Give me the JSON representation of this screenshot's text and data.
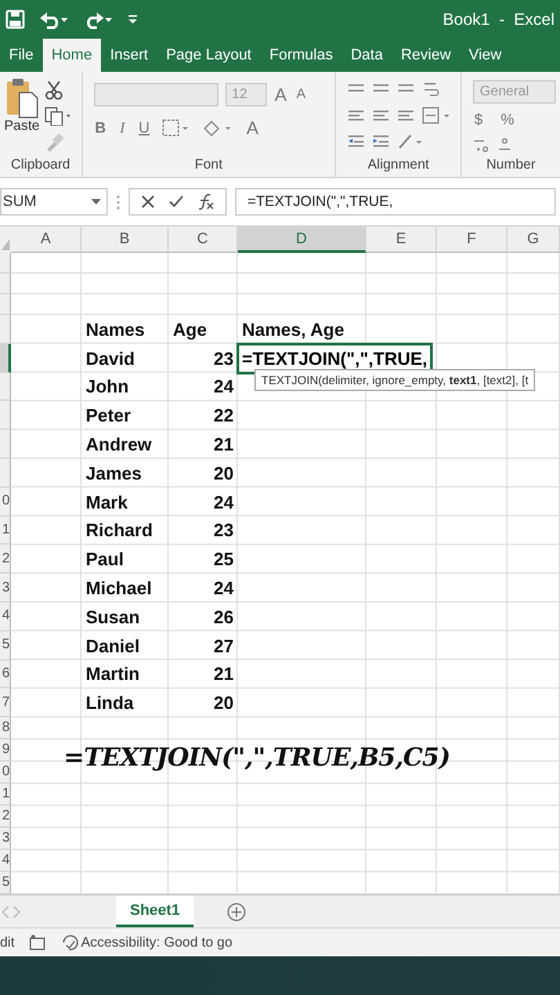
{
  "title_bar": {
    "title": "Book1  -  Excel"
  },
  "tabs": [
    {
      "label": "File",
      "selected": false
    },
    {
      "label": "Home",
      "selected": true
    },
    {
      "label": "Insert",
      "selected": false
    },
    {
      "label": "Page Layout",
      "selected": false
    },
    {
      "label": "Formulas",
      "selected": false
    },
    {
      "label": "Data",
      "selected": false
    },
    {
      "label": "Review",
      "selected": false
    },
    {
      "label": "View",
      "selected": false
    }
  ],
  "ribbon": {
    "paste_label": "Paste",
    "groups": [
      "Clipboard",
      "Font",
      "Alignment",
      "Number"
    ],
    "font_size": "12",
    "font_styles": [
      "B",
      "I",
      "U"
    ],
    "grow_font": "A",
    "shrink_font": "A",
    "font_color": "A",
    "number_format": "General",
    "currency": "$",
    "percent": "%"
  },
  "formula_bar": {
    "name_box": "SUM",
    "formula": "=TEXTJOIN(\",\",TRUE,"
  },
  "columns": [
    {
      "label": "A",
      "selected": false
    },
    {
      "label": "B",
      "selected": false
    },
    {
      "label": "C",
      "selected": false
    },
    {
      "label": "D",
      "selected": true
    },
    {
      "label": "E",
      "selected": false
    },
    {
      "label": "F",
      "selected": false
    },
    {
      "label": "G",
      "selected": false
    }
  ],
  "rows": [
    {
      "selected": false,
      "cells": []
    },
    {
      "selected": false,
      "cells": []
    },
    {
      "selected": false,
      "cells": []
    },
    {
      "selected": false,
      "cells": [
        {
          "kind": "text",
          "text": "Names"
        },
        {
          "kind": "text",
          "text": "Age"
        },
        {
          "kind": "text",
          "text": "Names, Age"
        }
      ]
    },
    {
      "selected": true,
      "cells": [
        {
          "kind": "text",
          "text": "David"
        },
        {
          "kind": "number",
          "text": "23"
        },
        {
          "kind": "editing",
          "text": "=TEXTJOIN(\",\",TRUE,"
        }
      ]
    },
    {
      "selected": false,
      "cells": [
        {
          "kind": "text",
          "text": "John"
        },
        {
          "kind": "number",
          "text": "24"
        }
      ]
    },
    {
      "selected": false,
      "cells": [
        {
          "kind": "text",
          "text": "Peter"
        },
        {
          "kind": "number",
          "text": "22"
        }
      ]
    },
    {
      "selected": false,
      "cells": [
        {
          "kind": "text",
          "text": "Andrew"
        },
        {
          "kind": "number",
          "text": "21"
        }
      ]
    },
    {
      "selected": false,
      "cells": [
        {
          "kind": "text",
          "text": "James"
        },
        {
          "kind": "number",
          "text": "20"
        }
      ]
    },
    {
      "number": "0",
      "selected": false,
      "cells": [
        {
          "kind": "text",
          "text": "Mark"
        },
        {
          "kind": "number",
          "text": "24"
        }
      ]
    },
    {
      "number": "1",
      "selected": false,
      "cells": [
        {
          "kind": "text",
          "text": "Richard"
        },
        {
          "kind": "number",
          "text": "23"
        }
      ]
    },
    {
      "number": "2",
      "selected": false,
      "cells": [
        {
          "kind": "text",
          "text": "Paul"
        },
        {
          "kind": "number",
          "text": "25"
        }
      ]
    },
    {
      "number": "3",
      "selected": false,
      "cells": [
        {
          "kind": "text",
          "text": "Michael"
        },
        {
          "kind": "number",
          "text": "24"
        }
      ]
    },
    {
      "number": "4",
      "selected": false,
      "cells": [
        {
          "kind": "text",
          "text": "Susan"
        },
        {
          "kind": "number",
          "text": "26"
        }
      ]
    },
    {
      "number": "5",
      "selected": false,
      "cells": [
        {
          "kind": "text",
          "text": "Daniel"
        },
        {
          "kind": "number",
          "text": "27"
        }
      ]
    },
    {
      "number": "6",
      "selected": false,
      "cells": [
        {
          "kind": "text",
          "text": "Martin"
        },
        {
          "kind": "number",
          "text": "21"
        }
      ]
    },
    {
      "number": "7",
      "selected": false,
      "cells": [
        {
          "kind": "text",
          "text": "Linda"
        },
        {
          "kind": "number",
          "text": "20"
        }
      ]
    },
    {
      "number": "8",
      "selected": false,
      "cells": []
    },
    {
      "number": "9",
      "selected": false,
      "cells": []
    },
    {
      "number": "0",
      "selected": false,
      "cells": []
    },
    {
      "number": "1",
      "selected": false,
      "cells": []
    },
    {
      "number": "2",
      "selected": false,
      "cells": []
    },
    {
      "number": "3",
      "selected": false,
      "cells": []
    },
    {
      "number": "4",
      "selected": false,
      "cells": []
    },
    {
      "number": "5",
      "selected": false,
      "cells": []
    }
  ],
  "tooltip": {
    "text": "TEXTJOIN(delimiter, ignore_empty, **text1**, [text2], [t"
  },
  "annotation": {
    "text": "=TEXTJOIN(\",\",TRUE,B5,C5)"
  },
  "sheet_tabs": [
    {
      "label": "Sheet1",
      "selected": true
    }
  ],
  "status_bar": {
    "mode": "dit",
    "accessibility": "Accessibility: Good to go"
  }
}
